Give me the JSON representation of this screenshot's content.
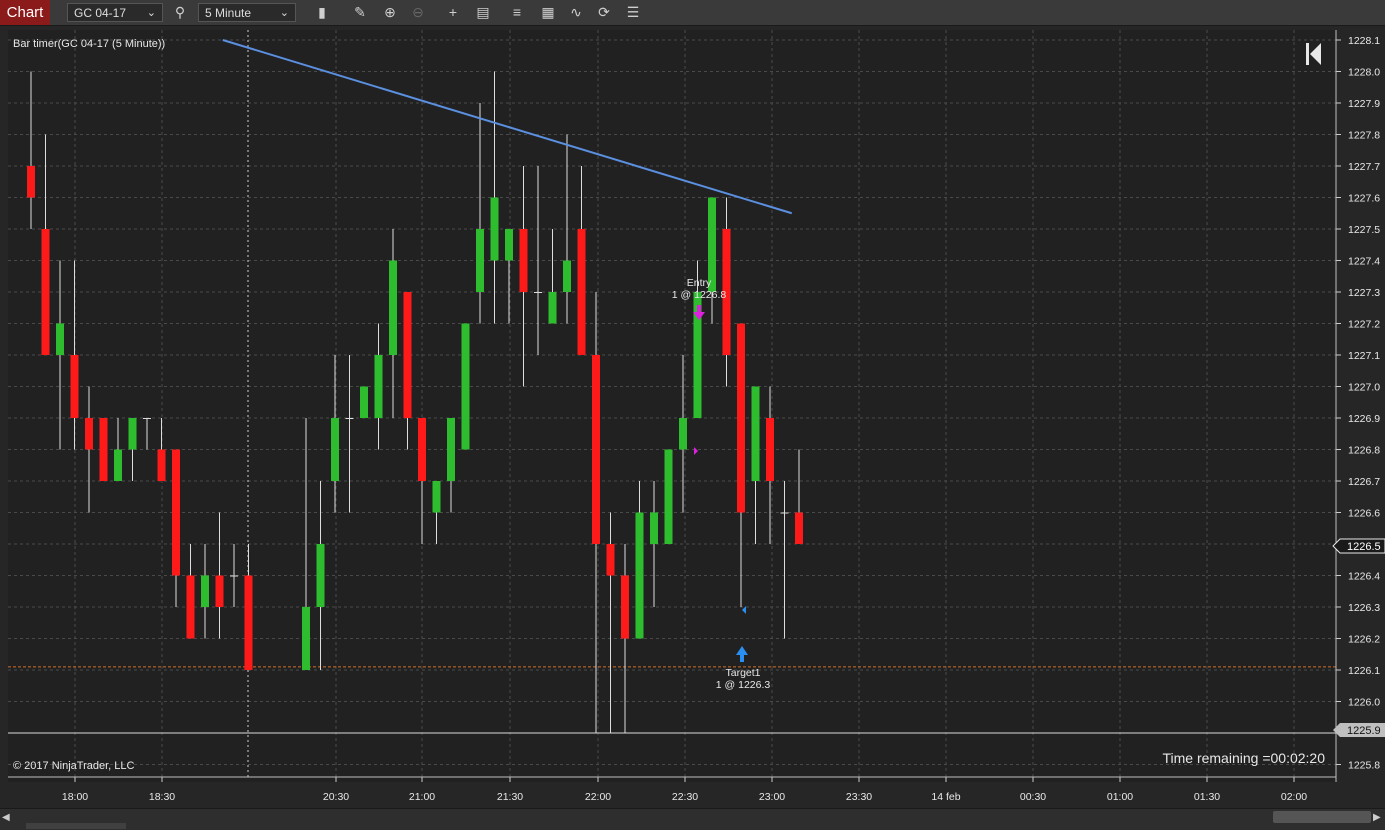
{
  "toolbar": {
    "chart_tab": "Chart",
    "instrument": "GC 04-17",
    "interval": "5 Minute",
    "buttons": [
      "bars-icon",
      "pencil-icon",
      "zoom-in-icon",
      "zoom-out-icon",
      "crosshair-icon",
      "data-box-icon",
      "indicators-icon",
      "strategies-icon",
      "drawing-tools-icon",
      "reload-icon",
      "properties-icon"
    ]
  },
  "chart": {
    "indicator_label": "Bar timer(GC 04-17 (5 Minute))",
    "copyright": "© 2017 NinjaTrader, LLC",
    "time_remaining": "Time remaining =00:02:20",
    "price_ticks": [
      "1228.1",
      "1228.0",
      "1227.9",
      "1227.8",
      "1227.7",
      "1227.6",
      "1227.5",
      "1227.4",
      "1227.3",
      "1227.2",
      "1227.1",
      "1227.0",
      "1226.9",
      "1226.8",
      "1226.7",
      "1226.6",
      "1226.5",
      "1226.4",
      "1226.3",
      "1226.2",
      "1226.1",
      "1226.0",
      "1225.9",
      "1225.8"
    ],
    "time_ticks": [
      "18:00",
      "18:30",
      "20:30",
      "21:00",
      "21:30",
      "22:00",
      "22:30",
      "23:00",
      "23:30",
      "14 feb",
      "00:30",
      "01:00",
      "01:30",
      "02:00"
    ],
    "last_price_label": "1226.5",
    "line_price_label": "1225.9",
    "orders": {
      "entry_title": "Entry",
      "entry_detail": "1 @ 1226.8",
      "target_title": "Target1",
      "target_detail": "1 @ 1226.3"
    },
    "colors": {
      "up": "#2ebd2e",
      "down": "#ff1a1a",
      "trendline": "#5b8fe0",
      "entry_marker": "#e020e0",
      "target_marker": "#2a8ff0"
    }
  },
  "chart_data": {
    "type": "candlestick",
    "ylim": [
      1225.75,
      1228.15
    ],
    "candles": [
      {
        "o": 1227.7,
        "h": 1228.0,
        "l": 1227.5,
        "c": 1227.6
      },
      {
        "o": 1227.5,
        "h": 1227.8,
        "l": 1227.1,
        "c": 1227.1
      },
      {
        "o": 1227.1,
        "h": 1227.4,
        "l": 1226.8,
        "c": 1227.2
      },
      {
        "o": 1227.1,
        "h": 1227.4,
        "l": 1226.8,
        "c": 1226.9
      },
      {
        "o": 1226.9,
        "h": 1227.0,
        "l": 1226.6,
        "c": 1226.8
      },
      {
        "o": 1226.9,
        "h": 1226.9,
        "l": 1226.7,
        "c": 1226.7
      },
      {
        "o": 1226.7,
        "h": 1226.9,
        "l": 1226.7,
        "c": 1226.8
      },
      {
        "o": 1226.8,
        "h": 1226.9,
        "l": 1226.7,
        "c": 1226.9
      },
      {
        "o": 1226.9,
        "h": 1226.9,
        "l": 1226.8,
        "c": 1226.9
      },
      {
        "o": 1226.8,
        "h": 1226.9,
        "l": 1226.7,
        "c": 1226.7
      },
      {
        "o": 1226.8,
        "h": 1226.8,
        "l": 1226.3,
        "c": 1226.4
      },
      {
        "o": 1226.4,
        "h": 1226.5,
        "l": 1226.2,
        "c": 1226.2
      },
      {
        "o": 1226.3,
        "h": 1226.5,
        "l": 1226.2,
        "c": 1226.4
      },
      {
        "o": 1226.4,
        "h": 1226.6,
        "l": 1226.2,
        "c": 1226.3
      },
      {
        "o": 1226.4,
        "h": 1226.5,
        "l": 1226.3,
        "c": 1226.4
      },
      {
        "o": 1226.4,
        "h": 1226.5,
        "l": 1226.1,
        "c": 1226.1
      },
      {
        "o": 1226.1,
        "h": 1226.9,
        "l": 1226.1,
        "c": 1226.3
      },
      {
        "o": 1226.3,
        "h": 1226.7,
        "l": 1226.1,
        "c": 1226.5
      },
      {
        "o": 1226.7,
        "h": 1227.1,
        "l": 1226.6,
        "c": 1226.9
      },
      {
        "o": 1226.9,
        "h": 1227.1,
        "l": 1226.6,
        "c": 1226.9
      },
      {
        "o": 1226.9,
        "h": 1227.0,
        "l": 1226.9,
        "c": 1227.0
      },
      {
        "o": 1226.9,
        "h": 1227.2,
        "l": 1226.8,
        "c": 1227.1
      },
      {
        "o": 1227.1,
        "h": 1227.5,
        "l": 1226.9,
        "c": 1227.4
      },
      {
        "o": 1227.3,
        "h": 1227.3,
        "l": 1226.8,
        "c": 1226.9
      },
      {
        "o": 1226.9,
        "h": 1226.9,
        "l": 1226.5,
        "c": 1226.7
      },
      {
        "o": 1226.6,
        "h": 1226.7,
        "l": 1226.5,
        "c": 1226.7
      },
      {
        "o": 1226.7,
        "h": 1226.9,
        "l": 1226.6,
        "c": 1226.9
      },
      {
        "o": 1226.8,
        "h": 1227.2,
        "l": 1226.8,
        "c": 1227.2
      },
      {
        "o": 1227.3,
        "h": 1227.9,
        "l": 1227.2,
        "c": 1227.5
      },
      {
        "o": 1227.4,
        "h": 1228.0,
        "l": 1227.2,
        "c": 1227.6
      },
      {
        "o": 1227.4,
        "h": 1227.5,
        "l": 1227.2,
        "c": 1227.5
      },
      {
        "o": 1227.5,
        "h": 1227.7,
        "l": 1227.0,
        "c": 1227.3
      },
      {
        "o": 1227.3,
        "h": 1227.7,
        "l": 1227.1,
        "c": 1227.3
      },
      {
        "o": 1227.2,
        "h": 1227.5,
        "l": 1227.2,
        "c": 1227.3
      },
      {
        "o": 1227.3,
        "h": 1227.8,
        "l": 1227.2,
        "c": 1227.4
      },
      {
        "o": 1227.5,
        "h": 1227.7,
        "l": 1227.1,
        "c": 1227.1
      },
      {
        "o": 1227.1,
        "h": 1227.3,
        "l": 1225.9,
        "c": 1226.5
      },
      {
        "o": 1226.5,
        "h": 1226.6,
        "l": 1225.9,
        "c": 1226.4
      },
      {
        "o": 1226.4,
        "h": 1226.5,
        "l": 1225.9,
        "c": 1226.2
      },
      {
        "o": 1226.2,
        "h": 1226.7,
        "l": 1226.2,
        "c": 1226.6
      },
      {
        "o": 1226.5,
        "h": 1226.7,
        "l": 1226.3,
        "c": 1226.6
      },
      {
        "o": 1226.5,
        "h": 1226.7,
        "l": 1226.5,
        "c": 1226.8
      },
      {
        "o": 1226.8,
        "h": 1227.1,
        "l": 1226.6,
        "c": 1226.9
      },
      {
        "o": 1226.9,
        "h": 1227.4,
        "l": 1226.9,
        "c": 1227.3
      },
      {
        "o": 1227.3,
        "h": 1227.6,
        "l": 1227.2,
        "c": 1227.6
      },
      {
        "o": 1227.5,
        "h": 1227.6,
        "l": 1227.0,
        "c": 1227.1
      },
      {
        "o": 1227.2,
        "h": 1227.2,
        "l": 1226.3,
        "c": 1226.6
      },
      {
        "o": 1226.7,
        "h": 1227.0,
        "l": 1226.5,
        "c": 1227.0
      },
      {
        "o": 1226.9,
        "h": 1227.0,
        "l": 1226.5,
        "c": 1226.7
      },
      {
        "o": 1226.6,
        "h": 1226.7,
        "l": 1226.2,
        "c": 1226.6
      },
      {
        "o": 1226.6,
        "h": 1226.8,
        "l": 1226.5,
        "c": 1226.5
      }
    ],
    "trendline": {
      "from_bar": 13.5,
      "from_price": 1228.1,
      "to_bar": 49.5,
      "to_price": 1227.55
    },
    "horizontal_lines": [
      1226.11,
      1225.9
    ],
    "x_gap_after_bar": 15
  }
}
